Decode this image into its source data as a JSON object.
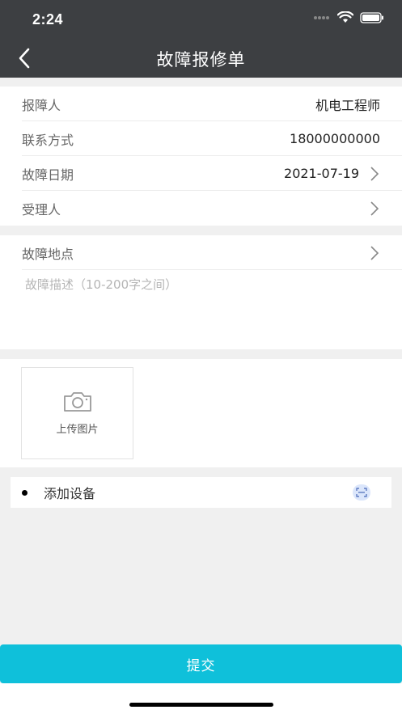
{
  "status_bar": {
    "time": "2:24"
  },
  "nav": {
    "title": "故障报修单"
  },
  "form": {
    "reporter_label": "报障人",
    "reporter_value": "机电工程师",
    "contact_label": "联系方式",
    "contact_value": "18000000000",
    "date_label": "故障日期",
    "date_value": "2021-07-19",
    "assignee_label": "受理人",
    "location_label": "故障地点",
    "description_placeholder": "故障描述（10-200字之间）"
  },
  "upload": {
    "label": "上传图片"
  },
  "device": {
    "label": "添加设备"
  },
  "actions": {
    "submit_label": "提交"
  },
  "colors": {
    "header_bg": "#3d3f42",
    "accent": "#0fc0da",
    "page_bg": "#f0f0f0"
  },
  "icons": [
    "back-arrow-icon",
    "wifi-icon",
    "battery-icon",
    "chevron-right-icon",
    "camera-icon",
    "scan-icon"
  ]
}
